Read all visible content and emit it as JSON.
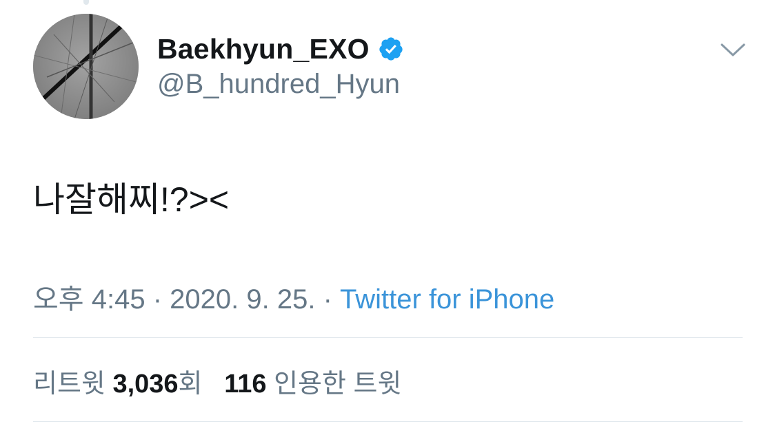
{
  "user": {
    "display_name": "Baekhyun_EXO",
    "handle": "@B_hundred_Hyun",
    "verified": true
  },
  "tweet": {
    "text": "나잘해찌!?><",
    "time": "오후 4:45",
    "date": "2020. 9. 25.",
    "separator": "·",
    "source": "Twitter for iPhone"
  },
  "stats": {
    "retweets_label": "리트윗",
    "retweets_count": "3,036",
    "retweets_suffix": "회",
    "quotes_count": "116",
    "quotes_label": "인용한 트윗"
  },
  "icons": {
    "verified": "verified-badge-icon",
    "more": "chevron-down-icon"
  },
  "colors": {
    "text": "#14171a",
    "secondary": "#657786",
    "link": "#3b94d9",
    "verified": "#1da1f2",
    "divider": "#e1e8ed"
  }
}
